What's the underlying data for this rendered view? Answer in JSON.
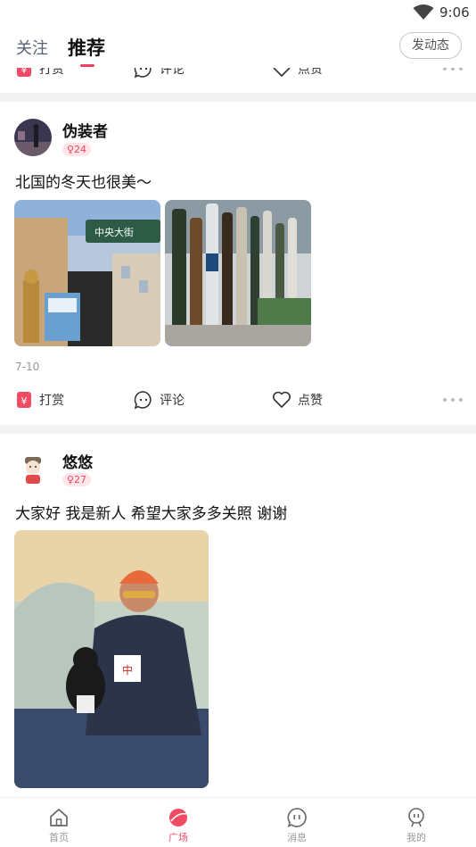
{
  "status_bar": {
    "time": "9:06"
  },
  "header": {
    "tabs": [
      {
        "label": "关注",
        "active": false
      },
      {
        "label": "推荐",
        "active": true
      }
    ],
    "post_button_label": "发动态"
  },
  "action_labels": {
    "reward": "打赏",
    "comment": "评论",
    "like": "点赞"
  },
  "posts": [
    {
      "username": "伪装者",
      "badge": "♀24",
      "text": "北国的冬天也很美～",
      "date": "7-10",
      "images": [
        "street-photo",
        "bottles-photo"
      ]
    },
    {
      "username": "悠悠",
      "badge": "♀27",
      "text": "大家好 我是新人 希望大家多多关照 谢谢",
      "images": [
        "portrait-photo"
      ]
    }
  ],
  "tabbar": {
    "items": [
      {
        "label": "首页",
        "icon": "home-icon",
        "active": false
      },
      {
        "label": "广场",
        "icon": "plaza-icon",
        "active": true
      },
      {
        "label": "消息",
        "icon": "message-icon",
        "active": false
      },
      {
        "label": "我的",
        "icon": "profile-icon",
        "active": false
      }
    ]
  },
  "colors": {
    "accent": "#f04a64",
    "divider": "#f3f3f3",
    "badge_bg": "#ffe4e8"
  }
}
